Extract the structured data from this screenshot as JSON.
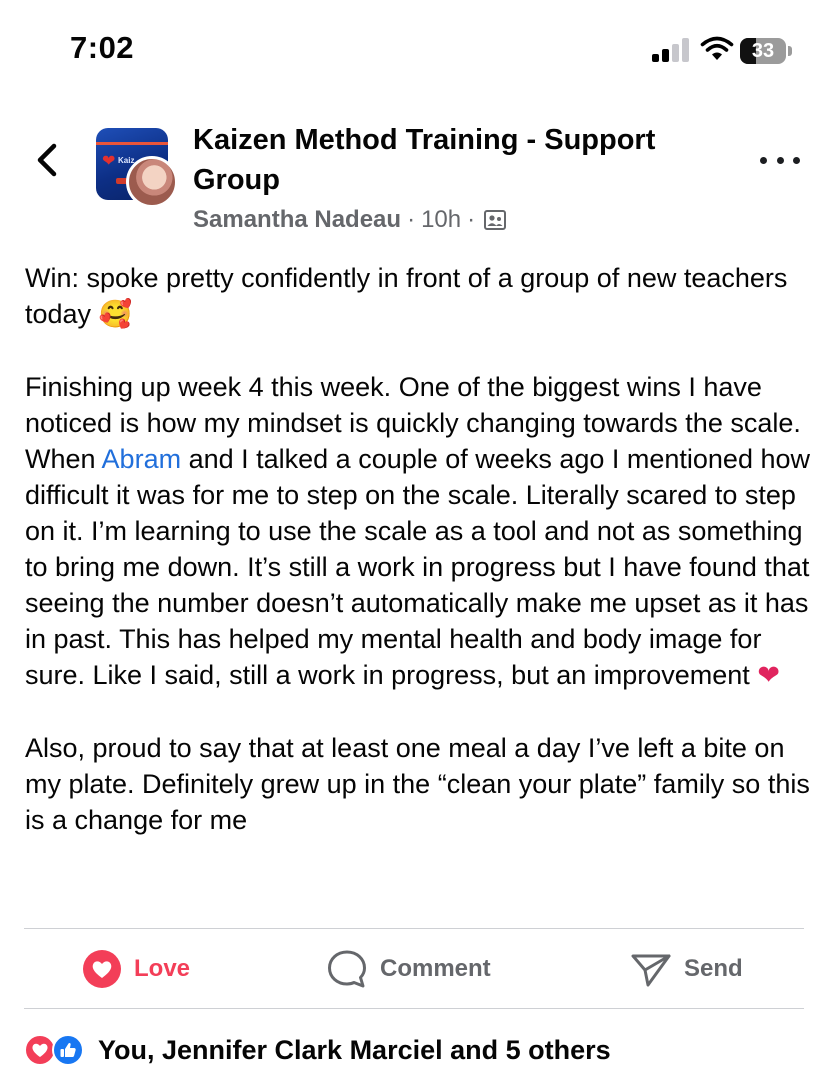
{
  "status_bar": {
    "time": "7:02",
    "battery": "33"
  },
  "header": {
    "back_icon": "chevron-left-icon",
    "group_name": "Kaizen Method Training - Support Group",
    "author": "Samantha Nadeau",
    "separator": "·",
    "time_ago": "10h",
    "audience_icon": "members-icon",
    "more_icon": "more-dots-icon"
  },
  "post": {
    "paragraph_1": "Win: spoke pretty confidently in front of a group of new teachers today",
    "emoji_1": "🥰",
    "paragraph_2_before_mention": "Finishing up week 4 this week. One of the biggest wins I have noticed is how my mindset is quickly changing towards the scale. When ",
    "mention": "Abram",
    "paragraph_2_after_mention": " and I talked a couple of weeks ago I mentioned how difficult it was for me to step on the scale. Literally scared to step on it. I’m learning to use the scale as a tool and not as something to bring me down. It’s still a work in progress but I have found that seeing the number doesn’t automatically make me upset as it has in past. This has helped my mental health and body image for sure. Like I said, still a work in progress, but an improvement",
    "emoji_2": "❤",
    "paragraph_3": "Also, proud to say that at least one meal a day I’ve left a bite on my plate. Definitely grew up in the “clean your plate” family so this is a change for me"
  },
  "actions": {
    "love_label": "Love",
    "comment_label": "Comment",
    "send_label": "Send"
  },
  "reactions": {
    "summary": "You, Jennifer Clark Marciel and 5 others"
  },
  "colors": {
    "love": "#f33e58",
    "mention": "#216fdb",
    "like": "#1877f2",
    "meta": "#65676b"
  }
}
